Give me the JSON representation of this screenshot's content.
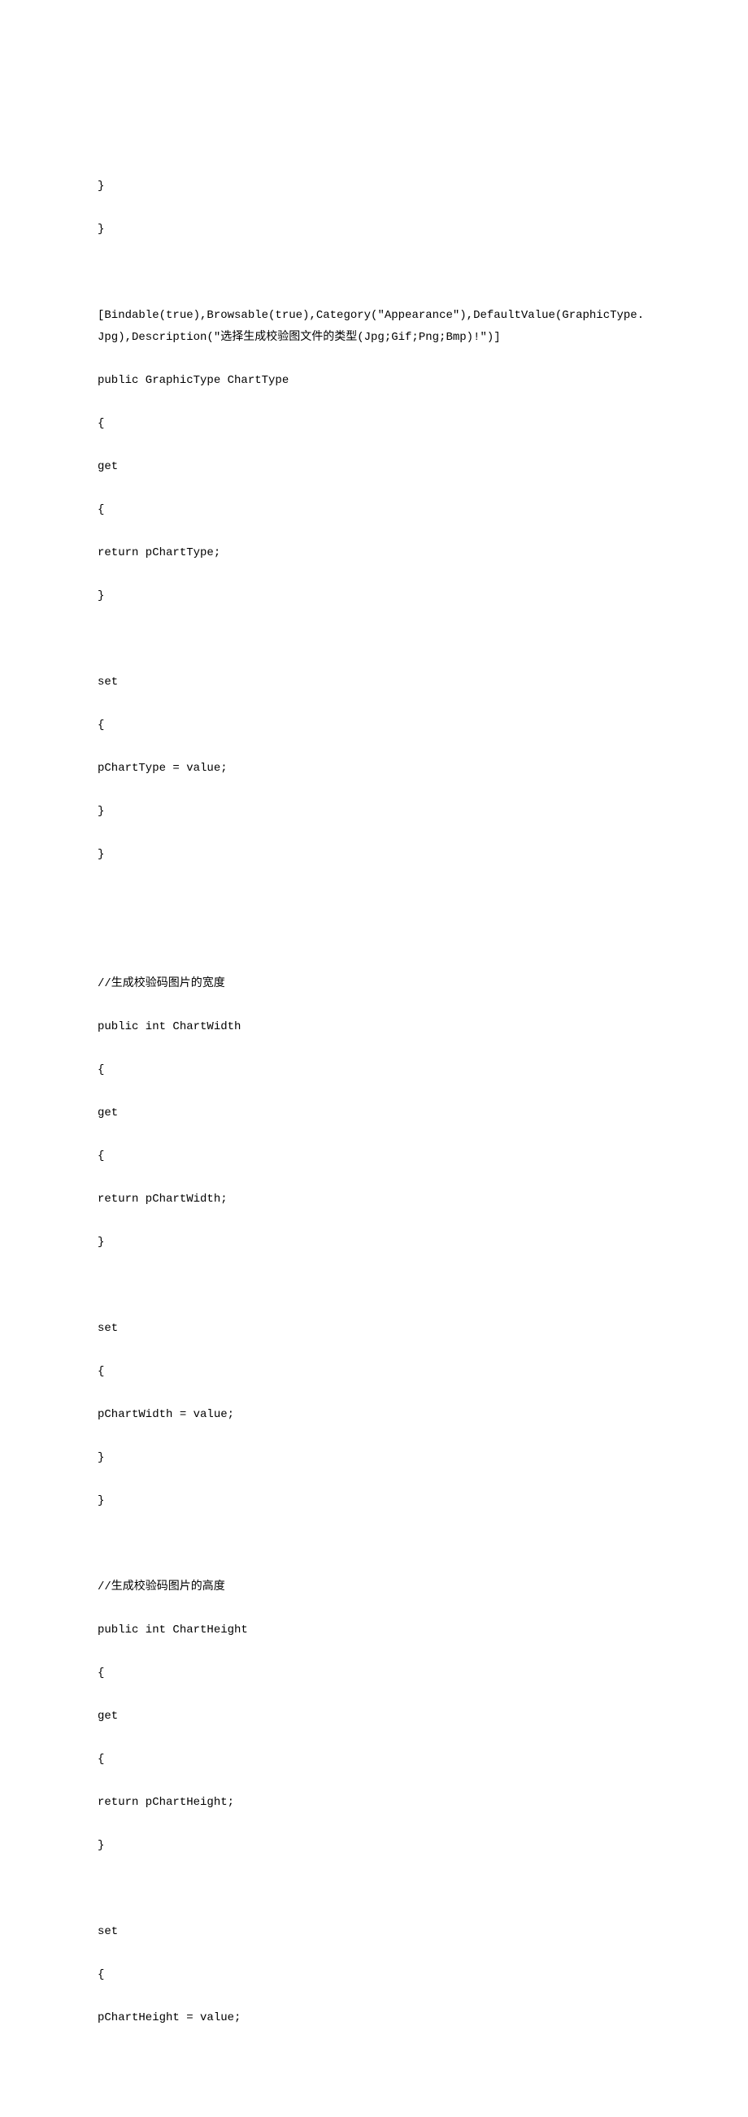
{
  "lines": {
    "l0": "}",
    "l1": "}",
    "l2": "[Bindable(true),Browsable(true),Category(\"Appearance\"),DefaultValue(GraphicType.Jpg),Description(\"选择生成校验图文件的类型(Jpg;Gif;Png;Bmp)!\")]",
    "l3": "public GraphicType ChartType",
    "l4": "{",
    "l5": "get",
    "l6": "{",
    "l7": "return pChartType;",
    "l8": "}",
    "l9": "set",
    "l10": "{",
    "l11": "pChartType = value;",
    "l12": "}",
    "l13": "}",
    "l14": "//生成校验码图片的宽度",
    "l15": "public int ChartWidth",
    "l16": "{",
    "l17": "get",
    "l18": "{",
    "l19": "return pChartWidth;",
    "l20": "}",
    "l21": "set",
    "l22": "{",
    "l23": "pChartWidth = value;",
    "l24": "}",
    "l25": "}",
    "l26": "//生成校验码图片的高度",
    "l27": "public int ChartHeight",
    "l28": "{",
    "l29": "get",
    "l30": "{",
    "l31": "return pChartHeight;",
    "l32": "}",
    "l33": "set",
    "l34": "{",
    "l35": "pChartHeight = value;"
  }
}
